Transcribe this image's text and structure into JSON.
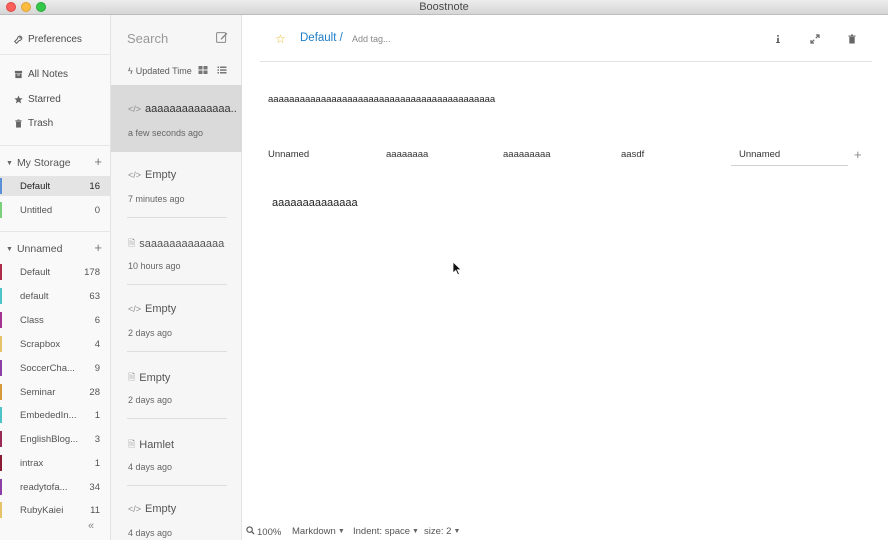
{
  "window": {
    "title": "Boostnote"
  },
  "sidebar": {
    "preferences": "Preferences",
    "nav": [
      {
        "label": "All Notes",
        "icon": "archive-icon"
      },
      {
        "label": "Starred",
        "icon": "star-icon"
      },
      {
        "label": "Trash",
        "icon": "trash-icon"
      }
    ],
    "storages": [
      {
        "name": "My Storage",
        "folders": [
          {
            "name": "Default",
            "count": "16",
            "color": "#5b8fd6",
            "active": true
          },
          {
            "name": "Untitled",
            "count": "0",
            "color": "#7bd17b"
          }
        ]
      },
      {
        "name": "Unnamed",
        "folders": [
          {
            "name": "Default",
            "count": "178",
            "color": "#b02a4a"
          },
          {
            "name": "default",
            "count": "63",
            "color": "#4dc3c9"
          },
          {
            "name": "Class",
            "count": "6",
            "color": "#a4348f"
          },
          {
            "name": "Scrapbox",
            "count": "4",
            "color": "#e6c36b"
          },
          {
            "name": "SoccerCha...",
            "count": "9",
            "color": "#8c3fa6"
          },
          {
            "name": "Seminar",
            "count": "28",
            "color": "#d49a3a"
          },
          {
            "name": "EmbededIn...",
            "count": "1",
            "color": "#4dc3c9"
          },
          {
            "name": "EnglishBlog...",
            "count": "3",
            "color": "#9a2b56"
          },
          {
            "name": "intrax",
            "count": "1",
            "color": "#8b1b32"
          },
          {
            "name": "readytofa...",
            "count": "34",
            "color": "#8c3fa6"
          },
          {
            "name": "RubyKaiei",
            "count": "11",
            "color": "#e6c36b"
          }
        ]
      }
    ],
    "collapse": "«"
  },
  "notelist": {
    "search_placeholder": "Search",
    "sort_label": "Updated Time",
    "notes": [
      {
        "type": "snippet",
        "title": "aaaaaaaaaaaaaa...",
        "time": "a few seconds ago",
        "active": true
      },
      {
        "type": "snippet",
        "title": "Empty",
        "time": "7 minutes ago"
      },
      {
        "type": "markdown",
        "title": "saaaaaaaaaaaaa",
        "time": "10 hours ago"
      },
      {
        "type": "snippet",
        "title": "Empty",
        "time": "2 days ago"
      },
      {
        "type": "markdown",
        "title": "Empty",
        "time": "2 days ago"
      },
      {
        "type": "markdown",
        "title": "Hamlet",
        "time": "4 days ago"
      },
      {
        "type": "snippet",
        "title": "Empty",
        "time": "4 days ago"
      }
    ]
  },
  "editor": {
    "folder_path": "Default /",
    "add_tag_placeholder": "Add tag...",
    "snippet_description": "aaaaaaaaaaaaaaaaaaaaaaaaaaaaaaaaaaaaaaaaaaa",
    "tabs": [
      "Unnamed",
      "aaaaaaaa",
      "aaaaaaaaa",
      "aasdf",
      "Unnamed"
    ],
    "tab_add": "+",
    "code": "aaaaaaaaaaaaaa"
  },
  "statusbar": {
    "zoom": "100%",
    "mode": "Markdown",
    "indent": "Indent: space",
    "size": "size: 2"
  }
}
